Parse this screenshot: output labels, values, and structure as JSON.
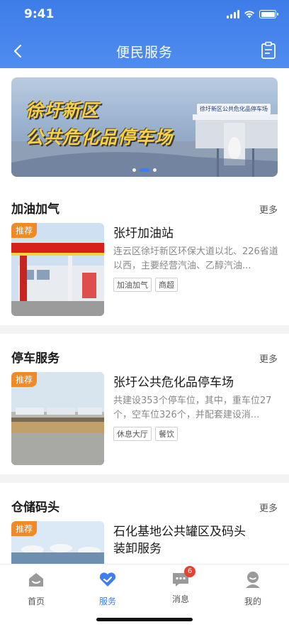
{
  "status": {
    "time": "9:41"
  },
  "nav": {
    "title": "便民服务"
  },
  "banner": {
    "headline_1": "徐圩新区",
    "headline_2": "公共危化品停车场",
    "sign_text": "徐圩新区公共危化品停车场",
    "slides": 3,
    "active_slide": 2
  },
  "sections": [
    {
      "title": "加油加气",
      "more": "更多",
      "card": {
        "badge": "推荐",
        "title": "张圩加油站",
        "desc": "连云区徐圩新区环保大道以北、226省道以西，主要经营汽油、乙醇汽油...",
        "tags": [
          "加油加气",
          "商超"
        ]
      }
    },
    {
      "title": "停车服务",
      "more": "更多",
      "card": {
        "badge": "推荐",
        "title": "张圩公共危化品停车场",
        "desc": "共建设353个停车位，其中，重车位27个，空车位326个，并配套建设消...",
        "tags": [
          "休息大厅",
          "餐饮"
        ]
      }
    },
    {
      "title": "仓储码头",
      "more": "更多",
      "card": {
        "badge": "推荐",
        "title": "石化基地公共罐区及码头装卸服务",
        "desc": "",
        "tags": []
      }
    }
  ],
  "tabbar": {
    "items": [
      {
        "label": "首页",
        "icon": "home-icon"
      },
      {
        "label": "服务",
        "icon": "service-heart-icon"
      },
      {
        "label": "消息",
        "icon": "message-icon",
        "badge": "6"
      },
      {
        "label": "我的",
        "icon": "profile-icon"
      }
    ],
    "active": 1
  },
  "colors": {
    "primary": "#3f7ef0",
    "accent": "#f08a28",
    "badge": "#e8412f"
  }
}
